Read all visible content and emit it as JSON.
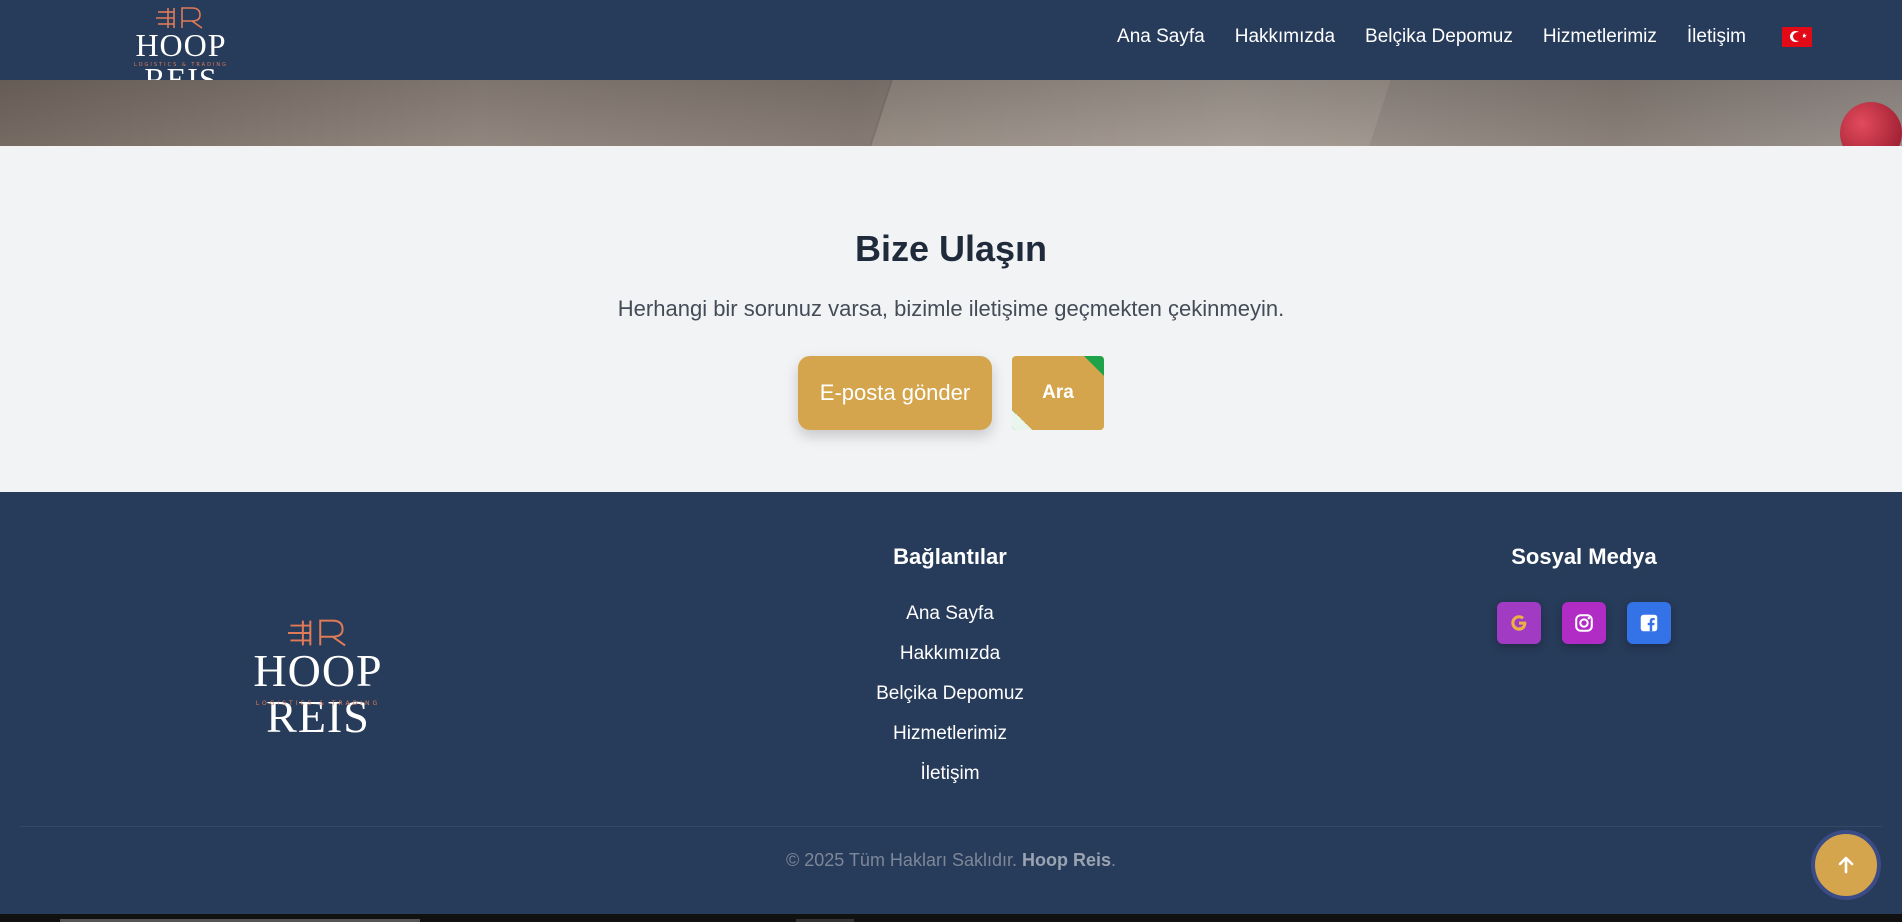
{
  "brand": {
    "name": "HOOP REIS",
    "tagline": "LOGISTICS & TRADING",
    "monogram": "HR",
    "accent_color": "#d4a54d",
    "mark_color": "#e07b57",
    "nav_bg": "#273b5a"
  },
  "nav": {
    "items": [
      {
        "label": "Ana Sayfa"
      },
      {
        "label": "Hakkımızda"
      },
      {
        "label": "Belçika Depomuz"
      },
      {
        "label": "Hizmetlerimiz"
      },
      {
        "label": "İletişim"
      }
    ],
    "language_flag": "turkey-flag-icon"
  },
  "contact": {
    "title": "Bize Ulaşın",
    "subtitle": "Herhangi bir sorunuz varsa, bizimle iletişime geçmekten çekinmeyin.",
    "email_button": "E-posta gönder",
    "call_button": "Ara"
  },
  "footer": {
    "links_title": "Bağlantılar",
    "links": [
      {
        "label": "Ana Sayfa"
      },
      {
        "label": "Hakkımızda"
      },
      {
        "label": "Belçika Depomuz"
      },
      {
        "label": "Hizmetlerimiz"
      },
      {
        "label": "İletişim"
      }
    ],
    "social_title": "Sosyal Medya",
    "social_icons": [
      "google-icon",
      "instagram-icon",
      "facebook-icon"
    ],
    "copyright_prefix": "© 2025 Tüm Hakları Saklıdır.",
    "copyright_brand": "Hoop Reis",
    "copyright_suffix": "."
  },
  "scroll_top_icon": "arrow-up-icon"
}
